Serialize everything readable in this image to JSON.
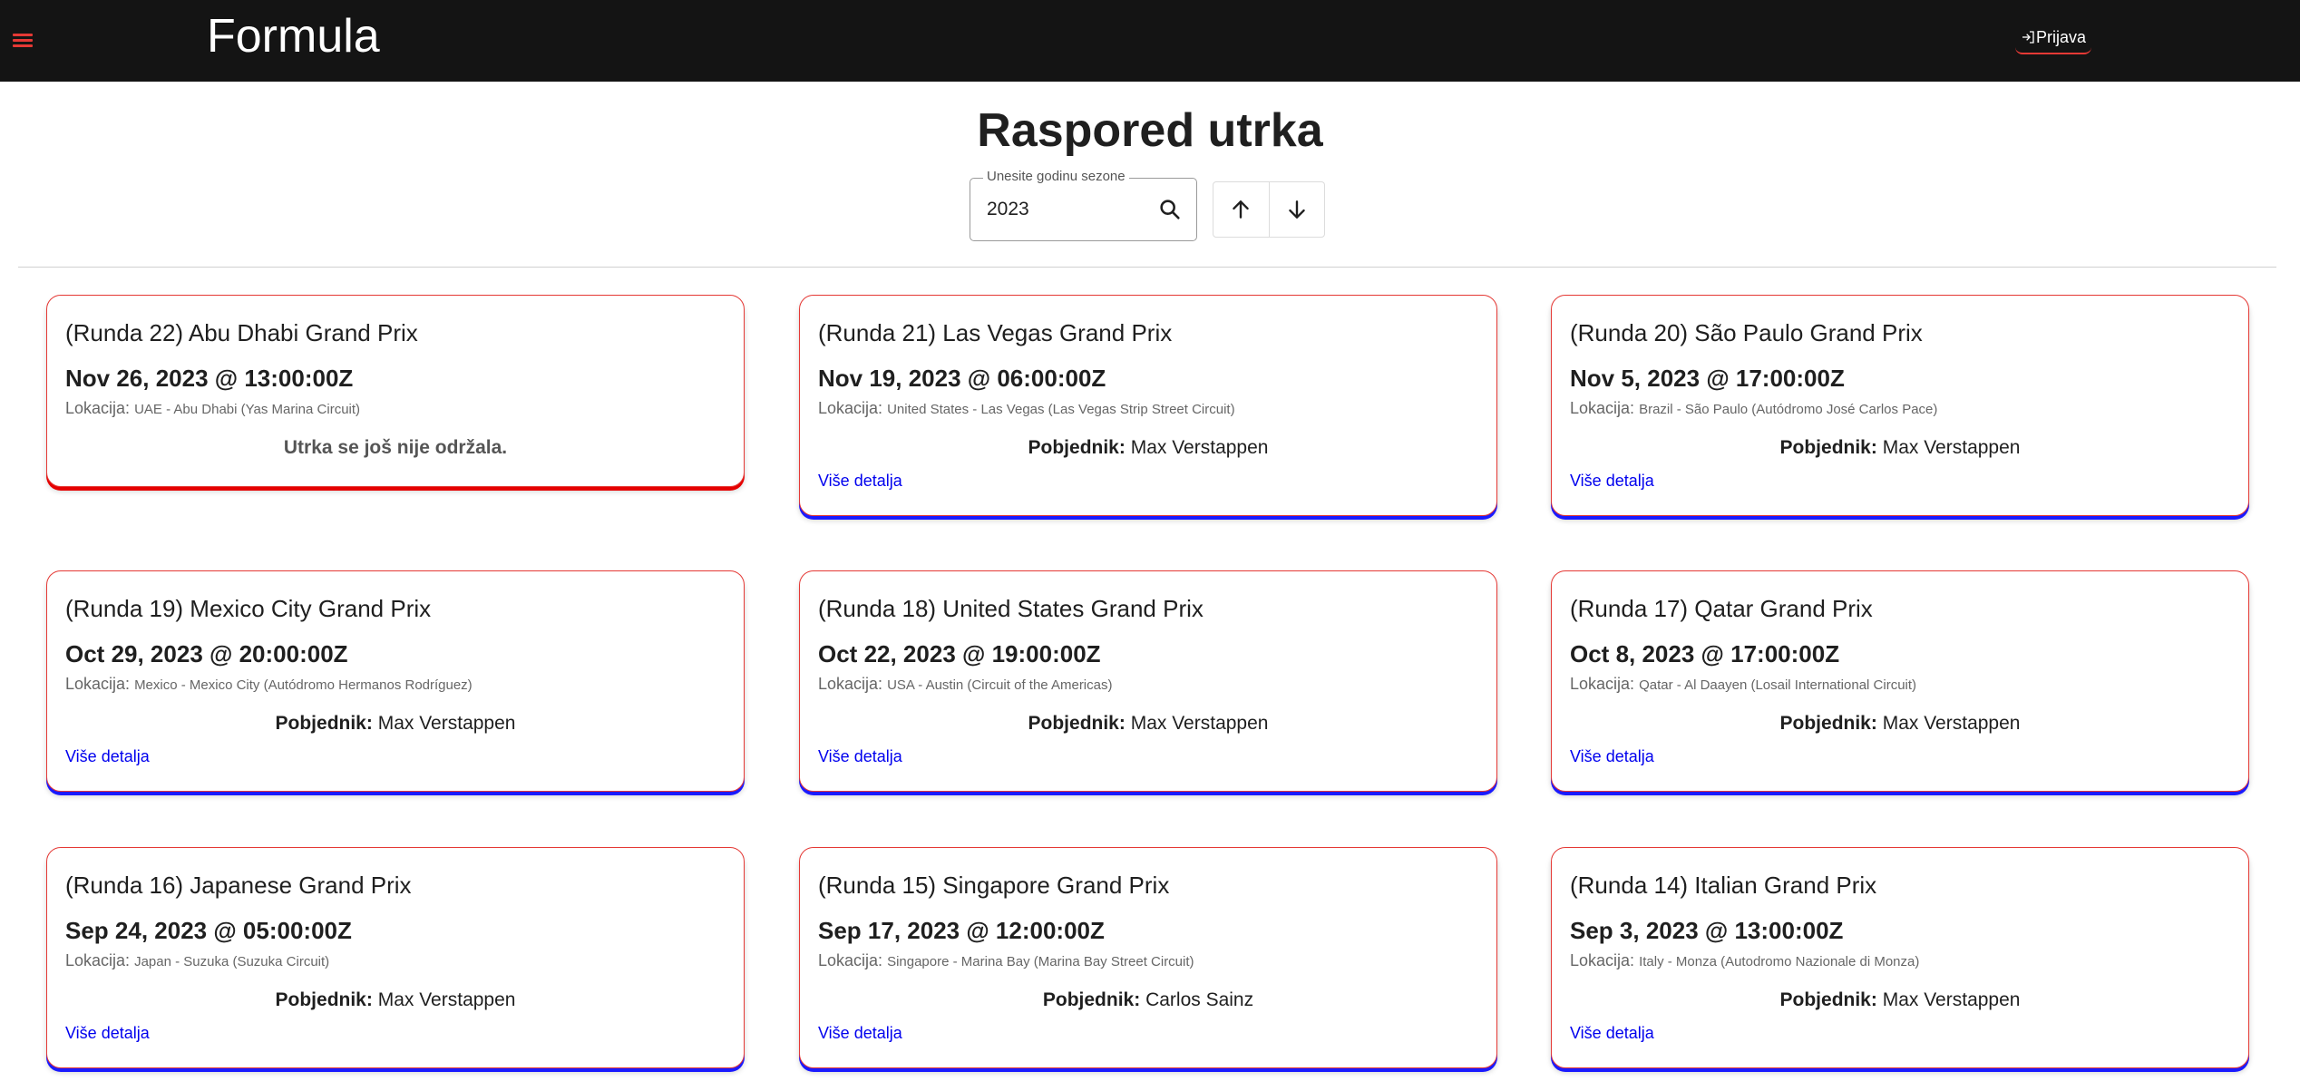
{
  "header": {
    "brand": "Formula",
    "login_label": "Prijava"
  },
  "page": {
    "title": "Raspored utrka"
  },
  "season": {
    "label": "Unesite godinu sezone",
    "value": "2023"
  },
  "colors": {
    "topbar": "#141414",
    "accent_red": "#e53935",
    "completed_underline": "#1a1aff",
    "link_blue": "#0000ee"
  },
  "labels": {
    "location": "Lokacija:",
    "winner": "Pobjednik:",
    "details": "Više detalja",
    "not_held": "Utrka se još nije održala."
  },
  "races": [
    {
      "title": "(Runda 22) Abu Dhabi Grand Prix",
      "date": "Nov 26, 2023 @ 13:00:00Z",
      "location": "UAE - Abu Dhabi (Yas Marina Circuit)",
      "winner": null
    },
    {
      "title": "(Runda 21) Las Vegas Grand Prix",
      "date": "Nov 19, 2023 @ 06:00:00Z",
      "location": "United States - Las Vegas (Las Vegas Strip Street Circuit)",
      "winner": "Max Verstappen"
    },
    {
      "title": "(Runda 20) São Paulo Grand Prix",
      "date": "Nov 5, 2023 @ 17:00:00Z",
      "location": "Brazil - São Paulo (Autódromo José Carlos Pace)",
      "winner": "Max Verstappen"
    },
    {
      "title": "(Runda 19) Mexico City Grand Prix",
      "date": "Oct 29, 2023 @ 20:00:00Z",
      "location": "Mexico - Mexico City (Autódromo Hermanos Rodríguez)",
      "winner": "Max Verstappen"
    },
    {
      "title": "(Runda 18) United States Grand Prix",
      "date": "Oct 22, 2023 @ 19:00:00Z",
      "location": "USA - Austin (Circuit of the Americas)",
      "winner": "Max Verstappen"
    },
    {
      "title": "(Runda 17) Qatar Grand Prix",
      "date": "Oct 8, 2023 @ 17:00:00Z",
      "location": "Qatar - Al Daayen (Losail International Circuit)",
      "winner": "Max Verstappen"
    },
    {
      "title": "(Runda 16) Japanese Grand Prix",
      "date": "Sep 24, 2023 @ 05:00:00Z",
      "location": "Japan - Suzuka (Suzuka Circuit)",
      "winner": "Max Verstappen"
    },
    {
      "title": "(Runda 15) Singapore Grand Prix",
      "date": "Sep 17, 2023 @ 12:00:00Z",
      "location": "Singapore - Marina Bay (Marina Bay Street Circuit)",
      "winner": "Carlos Sainz"
    },
    {
      "title": "(Runda 14) Italian Grand Prix",
      "date": "Sep 3, 2023 @ 13:00:00Z",
      "location": "Italy - Monza (Autodromo Nazionale di Monza)",
      "winner": "Max Verstappen"
    }
  ]
}
